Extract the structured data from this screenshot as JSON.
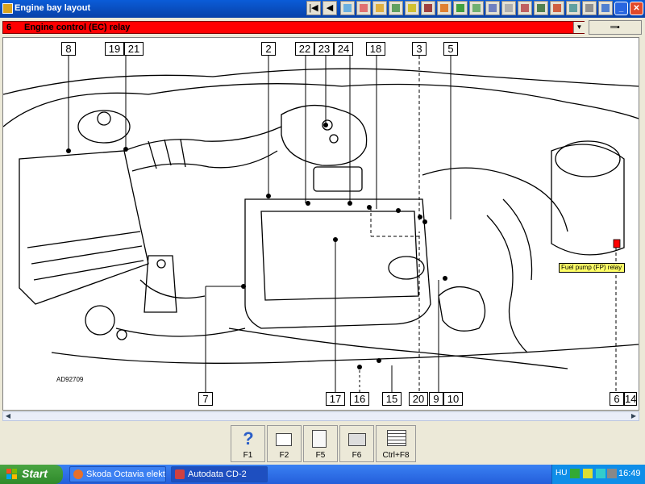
{
  "window": {
    "title": "Engine bay layout"
  },
  "toolbar": {
    "icons": [
      "first-page-icon",
      "prev-page-icon",
      "chart-icon",
      "mail-icon",
      "tool-icon",
      "wiring-icon",
      "battery-icon",
      "book-icon",
      "edit-icon",
      "car-icon",
      "monitor-icon",
      "stethoscope-icon",
      "clipboard-icon",
      "timer-icon",
      "oil-icon",
      "rocket-icon",
      "car-side-icon",
      "calculator-icon",
      "help-icon",
      "close-app-icon"
    ]
  },
  "selector": {
    "number": "6",
    "label": "Engine control (EC) relay"
  },
  "diagram": {
    "code": "AD92709",
    "tooltip": "Fuel pump (FP) relay",
    "top_labels": [
      "8",
      "19",
      "21",
      "2",
      "22",
      "23",
      "24",
      "18",
      "3",
      "5"
    ],
    "bottom_labels": [
      "7",
      "17",
      "16",
      "15",
      "20",
      "9",
      "10",
      "6",
      "14"
    ]
  },
  "function_keys": [
    {
      "label": "F1",
      "icon": "help-icon"
    },
    {
      "label": "F2",
      "icon": "print-icon"
    },
    {
      "label": "F5",
      "icon": "document-icon"
    },
    {
      "label": "F6",
      "icon": "printer-icon"
    },
    {
      "label": "Ctrl+F8",
      "icon": "table-icon"
    }
  ],
  "taskbar": {
    "start": "Start",
    "tasks": [
      "Skoda Octavia elektr...",
      "Autodata CD-2"
    ],
    "language": "HU",
    "time": "16:49"
  },
  "colors": {
    "titlebar": "#0a5cd8",
    "selector": "#ff0000",
    "tooltip": "#ffff66",
    "taskbar": "#245edb"
  }
}
